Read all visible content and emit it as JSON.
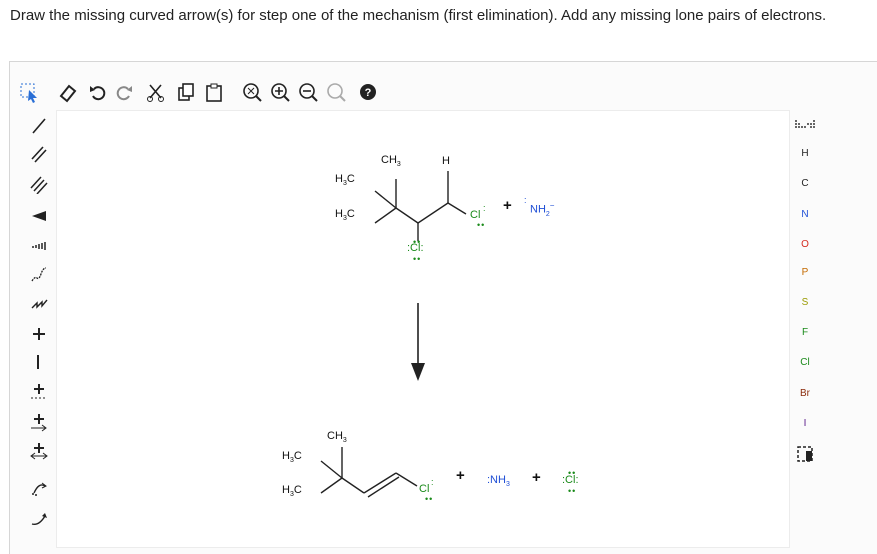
{
  "prompt": "Draw the missing curved arrow(s) for step one of the mechanism (first elimination). Add any missing lone pairs of electrons.",
  "toolbar": [
    {
      "name": "select-tool-icon"
    },
    {
      "name": "eraser-icon"
    },
    {
      "name": "undo-icon"
    },
    {
      "name": "redo-icon"
    },
    {
      "name": "cut-icon"
    },
    {
      "name": "copy-icon"
    },
    {
      "name": "paste-icon"
    },
    {
      "name": "zoom-fit-icon"
    },
    {
      "name": "zoom-in-icon"
    },
    {
      "name": "zoom-out-icon"
    },
    {
      "name": "zoom-reset-icon"
    },
    {
      "name": "help-icon"
    }
  ],
  "left_tools": [
    "single-bond-icon",
    "double-bond-icon",
    "triple-bond-icon",
    "wedge-bond-icon",
    "hash-bond-icon",
    "wavy-bond-icon",
    "chain-icon",
    "positive-charge-icon",
    "negative-charge-icon",
    "plus-radical-icon",
    "minus-radical-icon",
    "electron-icon",
    "curved-arrow-pair-icon",
    "curved-arrow-single-icon"
  ],
  "elements": {
    "periodic_label": "periodic-table-icon",
    "symbols": [
      "H",
      "C",
      "N",
      "O",
      "P",
      "S",
      "F",
      "Cl",
      "Br",
      "I"
    ],
    "colors": {
      "H": "#222222",
      "C": "#222222",
      "N": "#1f4fd6",
      "O": "#d42a1f",
      "P": "#c46a00",
      "S": "#9a9a00",
      "F": "#1a8a1a",
      "Cl": "#1a8a1a",
      "Br": "#8a2a0a",
      "I": "#5a1a8a"
    }
  },
  "molecules": {
    "top": {
      "ch3": "CH",
      "ch3_sub": "3",
      "h": "H",
      "h3c_a": "H",
      "h3c_a_sub": "3",
      "h3c_a_tail": "C",
      "h3c_b": "H",
      "h3c_b_sub": "3",
      "h3c_b_tail": "C",
      "cl_bound": "Cl",
      "cl_minus": ":Cl:",
      "plus": "+",
      "nh2": "NH",
      "nh2_sub": "2",
      "nh2_charge": "−"
    },
    "bottom": {
      "ch3": "CH",
      "ch3_sub": "3",
      "h3c_a": "H",
      "h3c_a_sub": "3",
      "h3c_a_tail": "C",
      "h3c_b": "H",
      "h3c_b_sub": "3",
      "h3c_b_tail": "C",
      "cl_bound": "Cl",
      "plus1": "+",
      "nh3": ":NH",
      "nh3_sub": "3",
      "plus2": "+",
      "cl_ion": ":Cl:"
    }
  }
}
